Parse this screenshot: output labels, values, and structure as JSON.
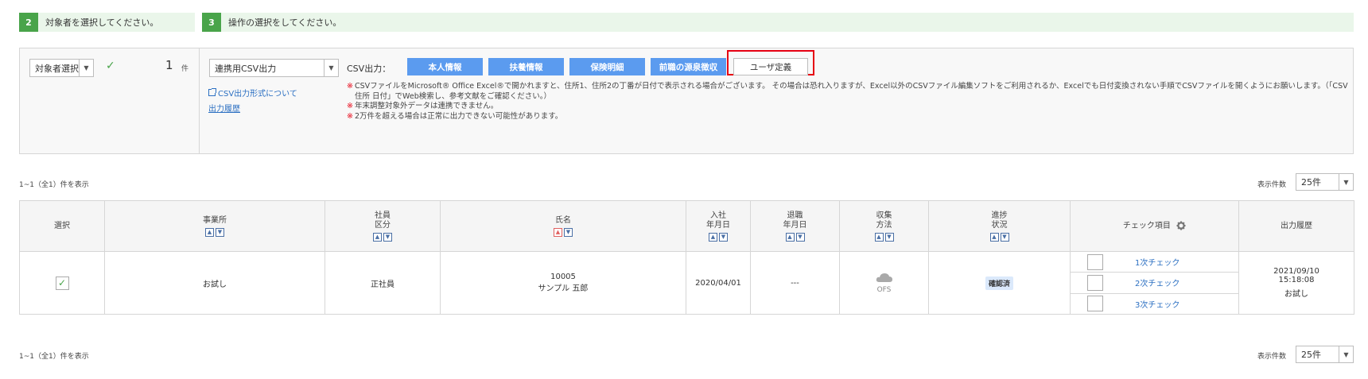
{
  "steps": {
    "step2": {
      "num": "2",
      "label": "対象者を選択してください。"
    },
    "step3": {
      "num": "3",
      "label": "操作の選択をしてください。"
    }
  },
  "target": {
    "select_value": "対象者選択",
    "count": "1",
    "unit": "件"
  },
  "operation": {
    "select_value": "連携用CSV出力",
    "csv_format_link": "CSV出力形式について",
    "history_link": "出力履歴",
    "csv_output_label": "CSV出力：",
    "buttons": {
      "honin": "本人情報",
      "fuyou": "扶養情報",
      "hoken": "保険明細",
      "zenshoku": "前職の源泉徴収",
      "user_def": "ユーザ定義"
    },
    "notes": [
      {
        "mark": "※",
        "text": "CSVファイルをMicrosoft® Office Excel®で開かれますと、住所1、住所2の丁番が日付で表示される場合がございます。 その場合は恐れ入りますが、Excel以外のCSVファイル編集ソフトをご利用されるか、Excelでも日付変換されない手順でCSVファイルを開くようにお願いします。（「CSV 住所 日付」でWeb検索し、参考文献をご確認ください。）"
      },
      {
        "mark": "※",
        "text": "年末調整対象外データは連携できません。"
      },
      {
        "mark": "※",
        "text": "2万件を超える場合は正常に出力できない可能性があります。"
      }
    ],
    "highlight_color": "#e60012"
  },
  "pager": {
    "info": "1~1（全1）件を表示",
    "size_label": "表示件数",
    "size_value": "25件"
  },
  "table": {
    "headers": {
      "select": "選択",
      "office": "事業所",
      "emp_type_1": "社員",
      "emp_type_2": "区分",
      "name": "氏名",
      "join_1": "入社",
      "join_2": "年月日",
      "leave_1": "退職",
      "leave_2": "年月日",
      "collect_1": "収集",
      "collect_2": "方法",
      "progress_1": "進捗",
      "progress_2": "状況",
      "check_items": "チェック項目",
      "history": "出力履歴"
    },
    "row": {
      "office": "お試し",
      "emp_type": "正社員",
      "emp_code": "10005",
      "emp_name": "サンプル 五郎",
      "join_date": "2020/04/01",
      "leave_date": "---",
      "collect_method": "OFS",
      "progress": "確認済",
      "checks": [
        "1次チェック",
        "2次チェック",
        "3次チェック"
      ],
      "history_date": "2021/09/10",
      "history_time": "15:18:08",
      "history_user": "お試し"
    }
  },
  "colors": {
    "accent_green": "#49a44a",
    "button_blue": "#5b9bef",
    "link_blue": "#2b6fc2"
  }
}
